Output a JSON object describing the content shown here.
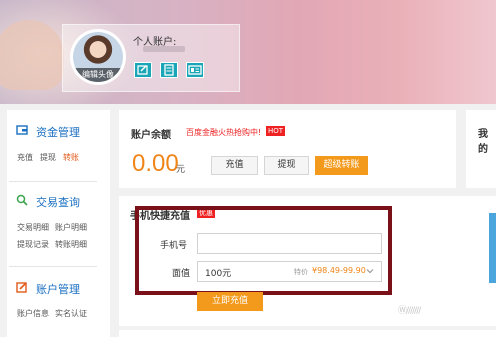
{
  "header": {
    "account_label": "个人账户:",
    "avatar_caption": "编辑头像",
    "icons": [
      "edit-icon",
      "calculator-icon",
      "id-card-icon"
    ]
  },
  "sidebar": {
    "sections": [
      {
        "title": "资金管理",
        "icon": "wallet-icon",
        "links": [
          "充值",
          "提现",
          "转账"
        ],
        "active": "转账"
      },
      {
        "title": "交易查询",
        "icon": "search-icon",
        "links": [
          "交易明细",
          "账户明细",
          "提现记录",
          "转账明细"
        ]
      },
      {
        "title": "账户管理",
        "icon": "edit-icon",
        "links": [
          "账户信息",
          "实名认证"
        ]
      }
    ]
  },
  "balance": {
    "title": "账户余额",
    "promo": "百度金融火热抢购中!",
    "hot_badge": "HOT",
    "amount": "0.00",
    "unit": "元",
    "buttons": {
      "recharge": "充值",
      "withdraw": "提现",
      "super_transfer": "超级转账"
    }
  },
  "right_card": {
    "title": "我的"
  },
  "recharge": {
    "title": "手机快捷充值",
    "badge": "优惠",
    "phone_label": "手机号",
    "phone_value": "",
    "face_value_label": "面值",
    "face_value_selected": "100元",
    "special_label": "特价",
    "special_price": "¥98.49-99.90",
    "submit": "立即充值"
  },
  "watermark": "Ⓦ///////",
  "colors": {
    "accent": "#f39a1d",
    "link_blue": "#1a6fc1",
    "highlight_border": "#7a1119",
    "teal_icon": "#1aa6b7",
    "hot_red": "#e22222"
  }
}
